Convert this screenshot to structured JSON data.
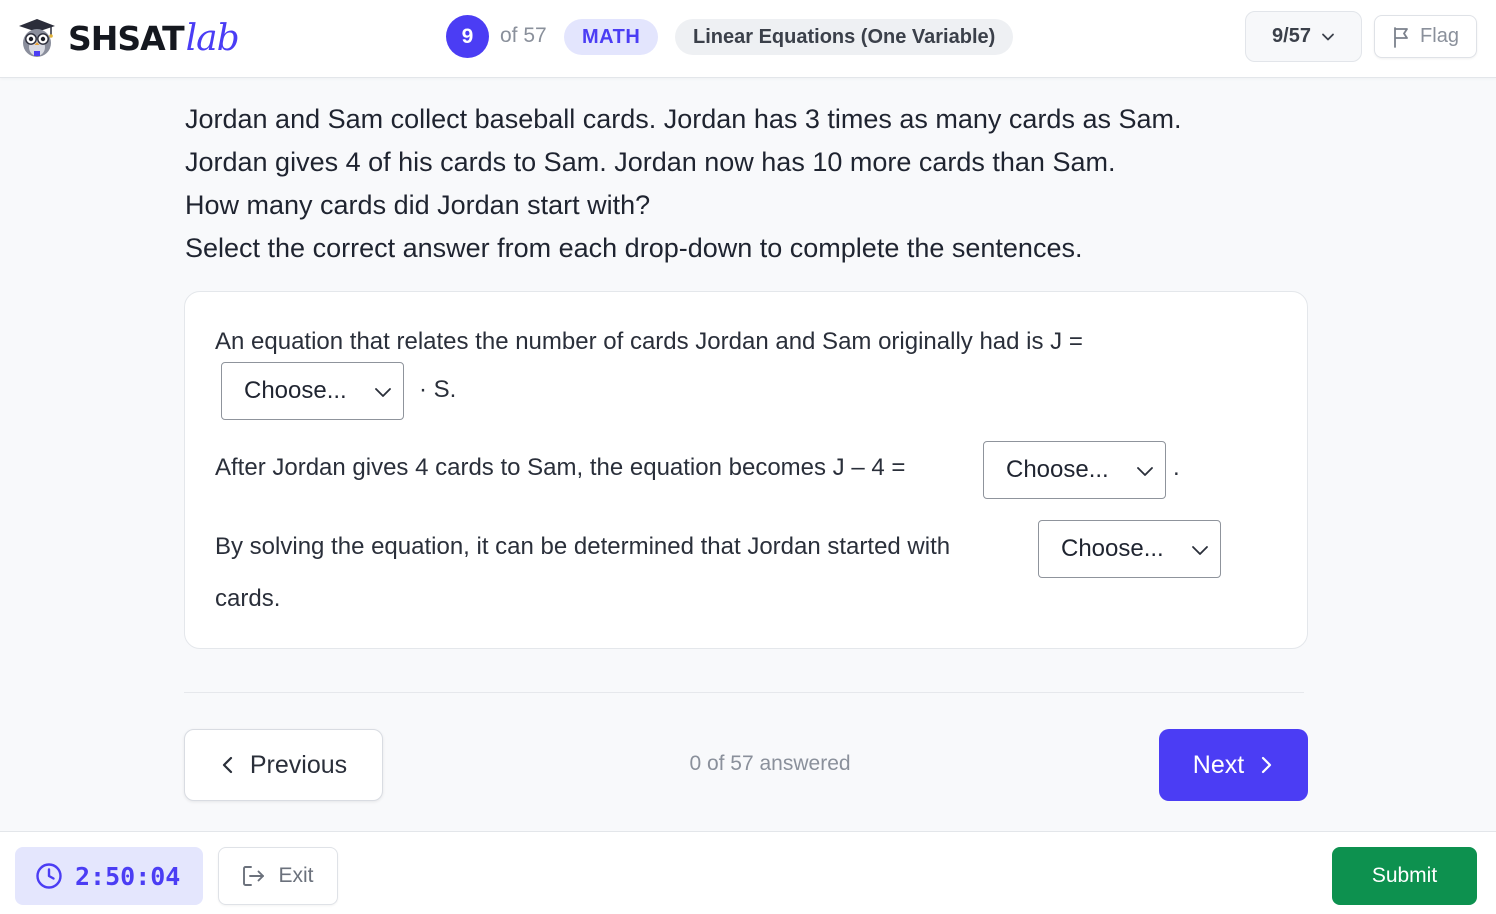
{
  "header": {
    "brand_main": "SHSAT",
    "brand_accent": "lab",
    "question_number": "9",
    "question_of": "of 57",
    "subject": "MATH",
    "topic": "Linear Equations (One Variable)",
    "nav_select_value": "9/57",
    "flag_label": "Flag"
  },
  "question": {
    "stem_lines": [
      "Jordan and Sam collect baseball cards. Jordan has 3 times as many cards as Sam.",
      "Jordan gives 4 of his cards to Sam. Jordan now has 10 more cards than Sam.",
      "How many cards did Jordan start with?",
      "Select the correct answer from each drop-down to complete the sentences."
    ],
    "parts": [
      {
        "before": "An equation that relates the number of cards Jordan and Sam originally had is J =",
        "after": "· S.",
        "dropdown_value": "Choose..."
      },
      {
        "before": "After Jordan gives 4 cards to Sam, the equation becomes J – 4 =",
        "after": ".",
        "dropdown_value": "Choose..."
      },
      {
        "before": "By solving the equation, it can be determined that Jordan started with",
        "after": "cards.",
        "dropdown_value": "Choose..."
      }
    ]
  },
  "navigation": {
    "previous_label": "Previous",
    "answered_status": "0 of 57 answered",
    "next_label": "Next"
  },
  "footer": {
    "timer": "2:50:04",
    "exit_label": "Exit",
    "submit_label": "Submit"
  },
  "colors": {
    "accent": "#4b3df4",
    "accent_soft": "#e3e5fd",
    "submit_green": "#0d914f"
  },
  "icons": {
    "logo": "owl-mascot-icon",
    "nav_select": "chevron-down-icon",
    "flag": "flag-icon",
    "dropdown": "chevron-down-icon",
    "previous": "chevron-left-icon",
    "next": "chevron-right-icon",
    "timer": "clock-icon",
    "exit": "logout-icon"
  }
}
